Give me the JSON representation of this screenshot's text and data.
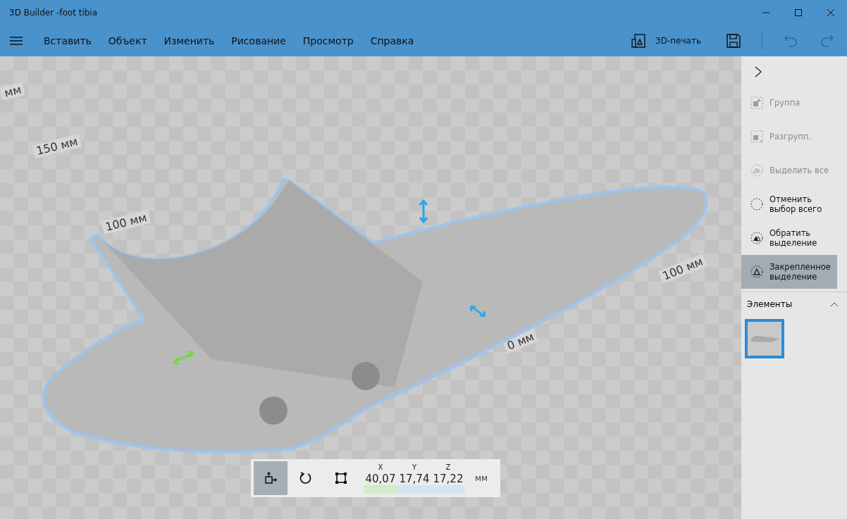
{
  "window": {
    "title": "3D Builder -foot tibia"
  },
  "menu": [
    {
      "label": "Вставить"
    },
    {
      "label": "Объект"
    },
    {
      "label": "Изменить"
    },
    {
      "label": "Рисование"
    },
    {
      "label": "Просмотр"
    },
    {
      "label": "Справка"
    }
  ],
  "toolbar": {
    "print_label": "3D-печать"
  },
  "viewport": {
    "grid_labels": [
      {
        "text": "мм"
      },
      {
        "text": "150 мм"
      },
      {
        "text": "100 мм"
      },
      {
        "text": "100 мм"
      },
      {
        "text": "0 мм"
      }
    ]
  },
  "sidebar": {
    "actions": [
      {
        "kind": "group",
        "label": "Группа",
        "disabled": true,
        "selected": false
      },
      {
        "kind": "ungroup",
        "label": "Разгрупп.",
        "disabled": true,
        "selected": false
      },
      {
        "kind": "select-all",
        "label": "Выделить все",
        "disabled": true,
        "selected": false
      },
      {
        "kind": "deselect",
        "label": "Отменить выбор всего",
        "disabled": false,
        "selected": false
      },
      {
        "kind": "invert",
        "label": "Обратить выделение",
        "disabled": false,
        "selected": false
      },
      {
        "kind": "sticky",
        "label": "Закрепленное выделение",
        "disabled": false,
        "selected": true
      }
    ],
    "elements": {
      "title": "Элементы",
      "expanded": true,
      "thumbnails": [
        {
          "selected": true
        }
      ]
    }
  },
  "transform": {
    "tools": [
      {
        "kind": "move",
        "selected": true
      },
      {
        "kind": "rotate",
        "selected": false
      },
      {
        "kind": "scale",
        "selected": false
      }
    ],
    "coords": [
      {
        "label": "X",
        "value": "40,07",
        "color": "#d2ecc6"
      },
      {
        "label": "Y",
        "value": "17,74",
        "color": "#d5e5ef"
      },
      {
        "label": "Z",
        "value": "17,22",
        "color": "#d5e5ef"
      }
    ],
    "unit": "мм"
  }
}
